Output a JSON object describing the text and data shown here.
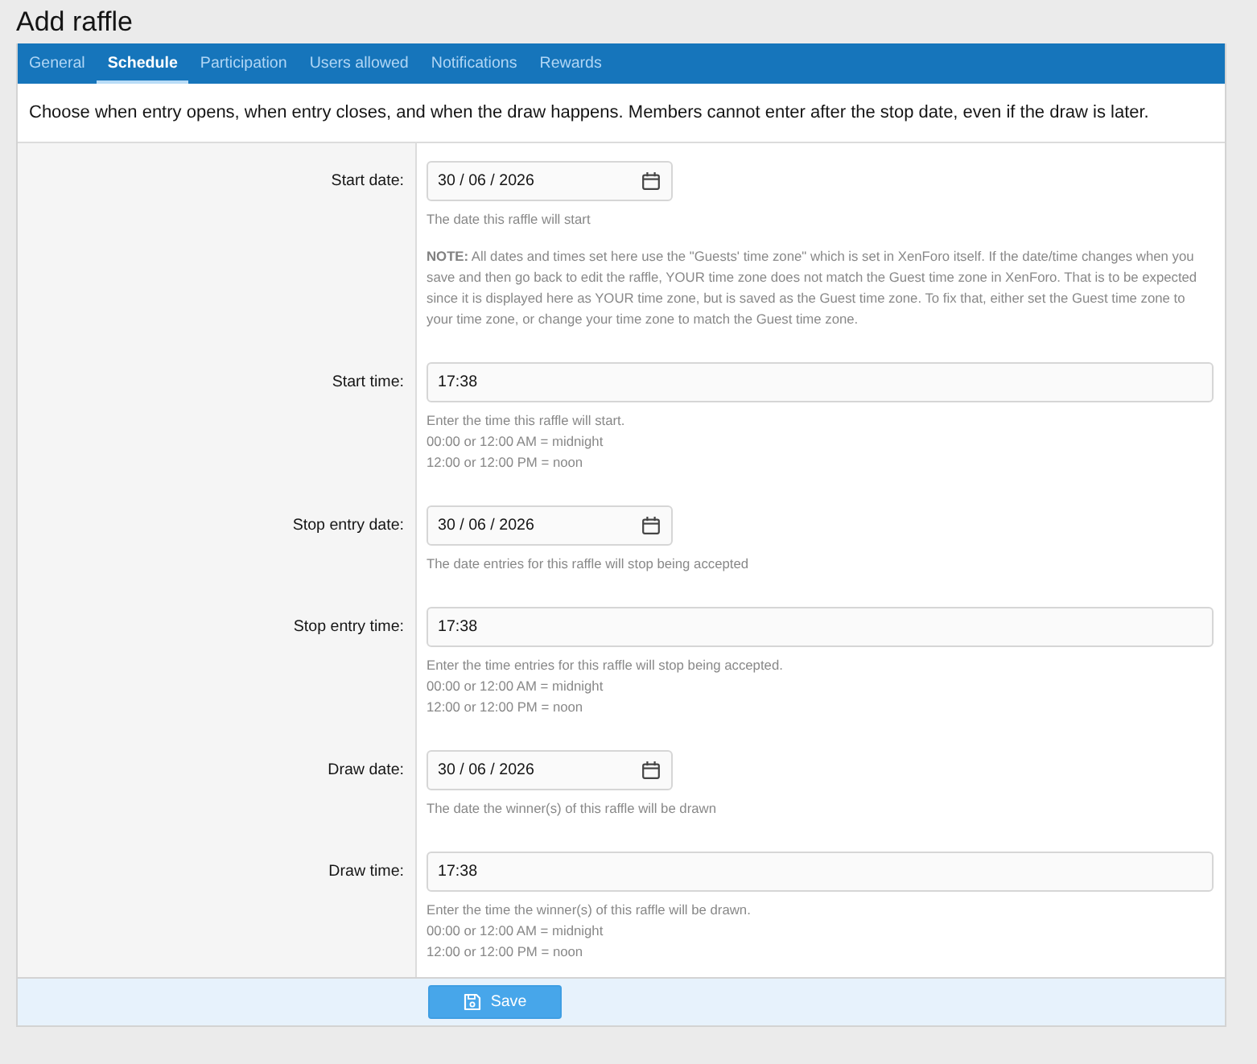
{
  "page": {
    "title": "Add raffle"
  },
  "tabs": [
    {
      "label": "General",
      "selected": false
    },
    {
      "label": "Schedule",
      "selected": true
    },
    {
      "label": "Participation",
      "selected": false
    },
    {
      "label": "Users allowed",
      "selected": false
    },
    {
      "label": "Notifications",
      "selected": false
    },
    {
      "label": "Rewards",
      "selected": false
    }
  ],
  "description": "Choose when entry opens, when entry closes, and when the draw happens. Members cannot enter after the stop date, even if the draw is later.",
  "rows": [
    {
      "kind": "date",
      "label": "Start date:",
      "value": "30 / 06 / 2026",
      "hints": [
        "The date this raffle will start"
      ],
      "note": "**NOTE:** All dates and times set here use the \"Guests' time zone\" which is set in XenForo itself. If the date/time changes when you save and then go back to edit the raffle, YOUR time zone does not match the Guest time zone in XenForo. That is to be expected since it is displayed here as YOUR time zone, but is saved as the Guest time zone. To fix that, either set the Guest time zone to your time zone, or change your time zone to match the Guest time zone."
    },
    {
      "kind": "time",
      "label": "Start time:",
      "value": "17:38",
      "hints": [
        "Enter the time this raffle will start.",
        "00:00 or 12:00 AM = midnight",
        "12:00 or 12:00 PM = noon"
      ]
    },
    {
      "kind": "date",
      "label": "Stop entry date:",
      "value": "30 / 06 / 2026",
      "hints": [
        "The date entries for this raffle will stop being accepted"
      ]
    },
    {
      "kind": "time",
      "label": "Stop entry time:",
      "value": "17:38",
      "hints": [
        "Enter the time entries for this raffle will stop being accepted.",
        "00:00 or 12:00 AM = midnight",
        "12:00 or 12:00 PM = noon"
      ]
    },
    {
      "kind": "date",
      "label": "Draw date:",
      "value": "30 / 06 / 2026",
      "hints": [
        "The date the winner(s) of this raffle will be drawn"
      ]
    },
    {
      "kind": "time",
      "label": "Draw time:",
      "value": "17:38",
      "hints": [
        "Enter the time the winner(s) of this raffle will be drawn.",
        "00:00 or 12:00 AM = midnight",
        "12:00 or 12:00 PM = noon"
      ]
    }
  ],
  "save_button": {
    "label": "Save"
  }
}
